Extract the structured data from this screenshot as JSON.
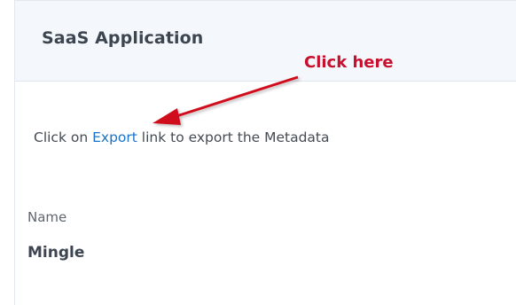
{
  "panel": {
    "title": "SaaS Application"
  },
  "annotation": {
    "label": "Click here",
    "color": "#c8102e"
  },
  "instruction": {
    "prefix": "Click on ",
    "link_text": "Export",
    "suffix": " link to export the Metadata"
  },
  "field": {
    "label": "Name",
    "value": "Mingle"
  },
  "colors": {
    "header_bg": "#f4f7fb",
    "link": "#1a73c8"
  }
}
